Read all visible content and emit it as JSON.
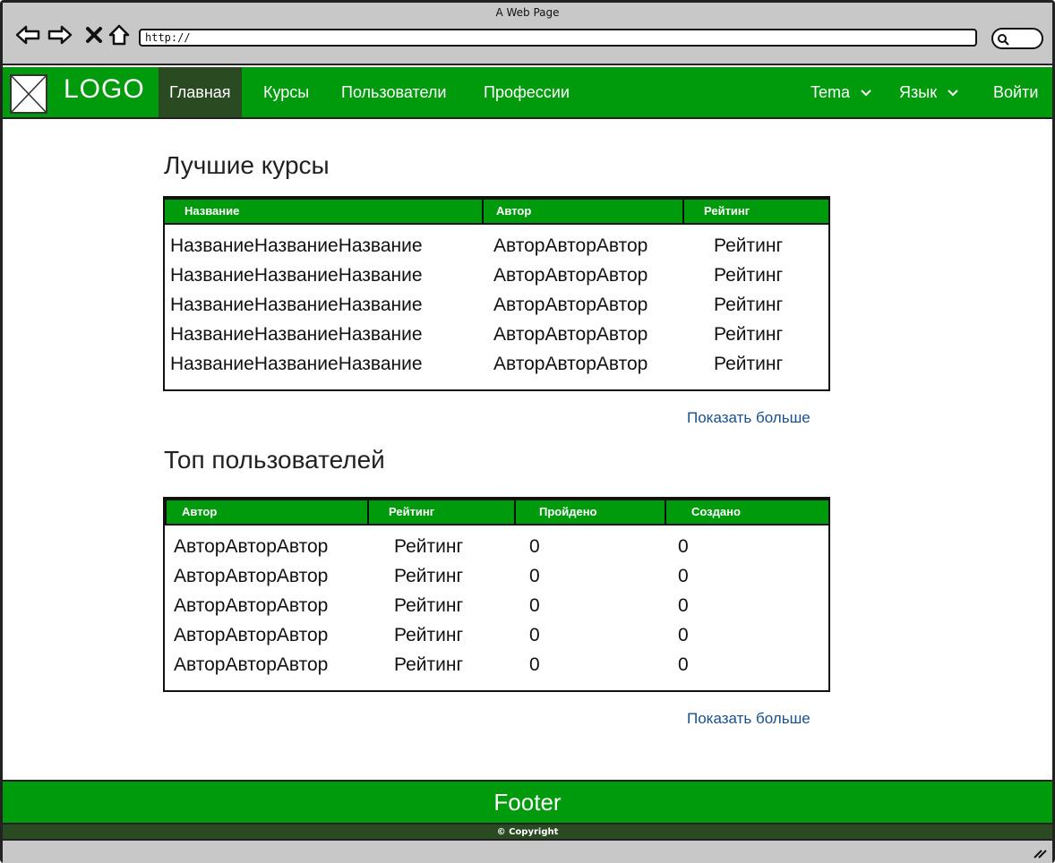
{
  "browser": {
    "window_title": "A Web Page",
    "url": "http://"
  },
  "nav": {
    "logo": "LOGO",
    "items": [
      {
        "label": "Главная",
        "active": true
      },
      {
        "label": "Курсы"
      },
      {
        "label": "Пользователи"
      },
      {
        "label": "Профессии"
      }
    ],
    "theme_label": "Tema",
    "language_label": "Язык",
    "login_label": "Войти"
  },
  "best_courses": {
    "title": "Лучшие курсы",
    "columns": [
      "Название",
      "Автор",
      "Рейтинг"
    ],
    "rows": [
      [
        "НазваниеНазваниеНазвание",
        "АвторАвторАвтор",
        "Рейтинг"
      ],
      [
        "НазваниеНазваниеНазвание",
        "АвторАвторАвтор",
        "Рейтинг"
      ],
      [
        "НазваниеНазваниеНазвание",
        "АвторАвторАвтор",
        "Рейтинг"
      ],
      [
        "НазваниеНазваниеНазвание",
        "АвторАвторАвтор",
        "Рейтинг"
      ],
      [
        "НазваниеНазваниеНазвание",
        "АвторАвторАвтор",
        "Рейтинг"
      ]
    ],
    "more_label": "Показать больше"
  },
  "top_users": {
    "title": "Топ пользователей",
    "columns": [
      "Автор",
      "Рейтинг",
      "Пройдено",
      "Создано"
    ],
    "rows": [
      [
        "АвторАвторАвтор",
        "Рейтинг",
        "0",
        "0"
      ],
      [
        "АвторАвторАвтор",
        "Рейтинг",
        "0",
        "0"
      ],
      [
        "АвторАвторАвтор",
        "Рейтинг",
        "0",
        "0"
      ],
      [
        "АвторАвторАвтор",
        "Рейтинг",
        "0",
        "0"
      ],
      [
        "АвторАвторАвтор",
        "Рейтинг",
        "0",
        "0"
      ]
    ],
    "more_label": "Показать больше"
  },
  "footer": {
    "label": "Footer",
    "copyright": "© Copyright"
  },
  "colors": {
    "brand_green": "#009b0c",
    "active_dark": "#2a4a22",
    "link_blue": "#1a4f8c"
  }
}
